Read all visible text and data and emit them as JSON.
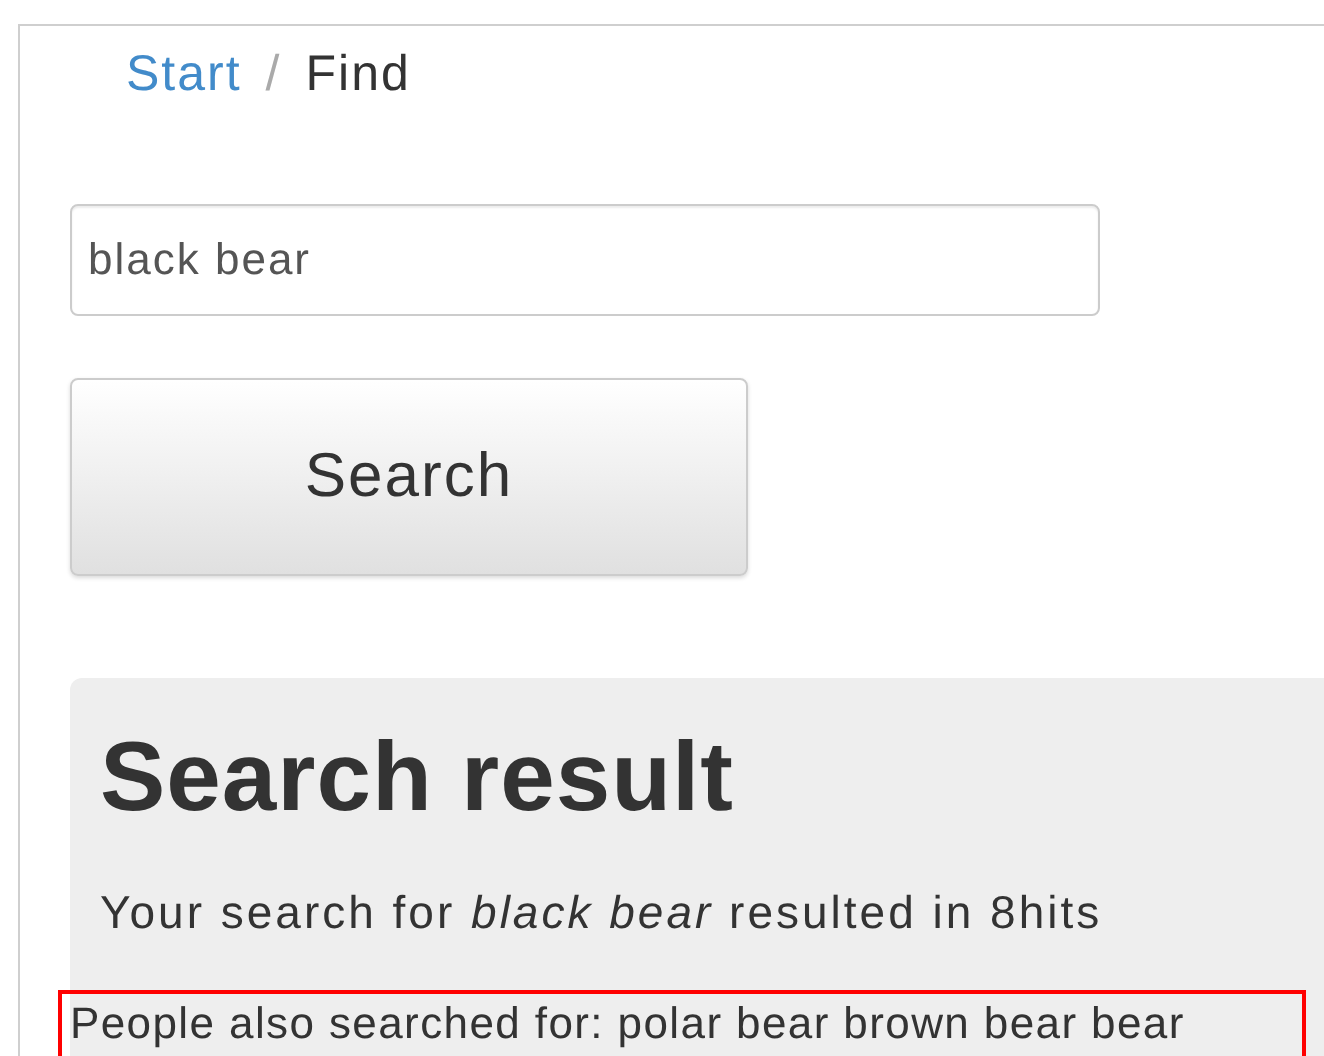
{
  "breadcrumb": [
    {
      "label": "Start",
      "kind": "link"
    },
    {
      "label": "Find",
      "kind": "current"
    }
  ],
  "breadcrumb_separator": "/",
  "search": {
    "value": "black bear"
  },
  "search_button": "Search",
  "result": {
    "title": "Search result",
    "summary": "Your search for *black bear* resulted in 8hits",
    "also_searched": "People also searched for: polar bear brown bear bear",
    "highlighted": true
  }
}
